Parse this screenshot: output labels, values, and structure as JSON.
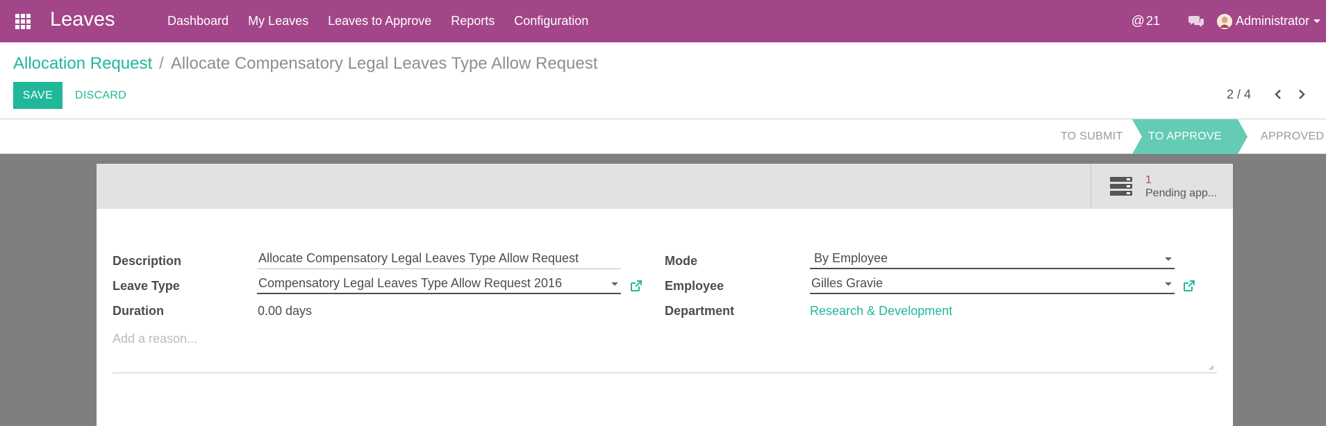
{
  "navbar": {
    "brand": "Leaves",
    "menu": [
      "Dashboard",
      "My Leaves",
      "Leaves to Approve",
      "Reports",
      "Configuration"
    ],
    "mentions_count": "21",
    "user": "Administrator",
    "color": "#a24689"
  },
  "breadcrumb": {
    "parent": "Allocation Request",
    "separator": "/",
    "current": "Allocate Compensatory Legal Leaves Type Allow Request"
  },
  "buttons": {
    "save": "SAVE",
    "discard": "DISCARD"
  },
  "pager": {
    "value": "2 / 4"
  },
  "statusbar": {
    "stages": [
      "TO SUBMIT",
      "TO APPROVE",
      "APPROVED"
    ],
    "active": "TO APPROVE",
    "active_color": "#64cbb5"
  },
  "smart_button": {
    "count": "1",
    "label": "Pending app..."
  },
  "form": {
    "description_label": "Description",
    "description_value": "Allocate Compensatory Legal Leaves Type Allow Request",
    "leave_type_label": "Leave Type",
    "leave_type_value": "Compensatory Legal Leaves Type Allow Request 2016",
    "duration_label": "Duration",
    "duration_value": "0.00 days",
    "mode_label": "Mode",
    "mode_value": "By Employee",
    "employee_label": "Employee",
    "employee_value": "Gilles Gravie",
    "department_label": "Department",
    "department_value": "Research & Development",
    "reason_placeholder": "Add a reason..."
  },
  "accent_color": "#21b799"
}
